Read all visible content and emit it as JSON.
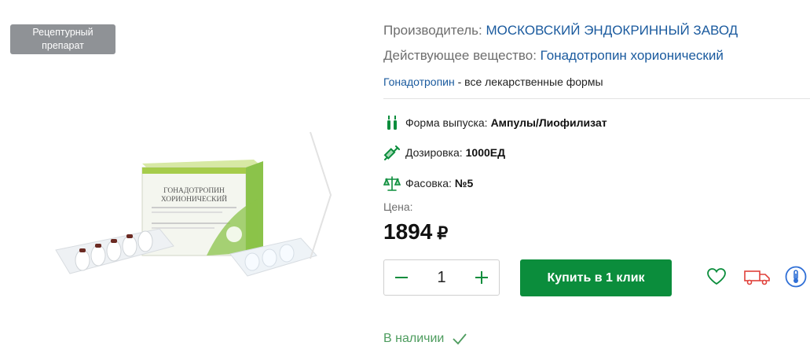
{
  "gallery": {
    "badge_line1": "Рецептурный",
    "badge_line2": "препарат",
    "box_title_line1": "ГОНАДОТРОПИН",
    "box_title_line2": "ХОРИОНИЧЕСКИЙ",
    "next_icon": "chevron-right-icon"
  },
  "product": {
    "manufacturer_label": "Производитель:",
    "manufacturer_value": "МОСКОВСКИЙ ЭНДОКРИННЫЙ ЗАВОД",
    "substance_label": "Действующее вещество:",
    "substance_value": "Гонадотропин хорионический",
    "all_forms_link": "Гонадотропин",
    "all_forms_text": "- все лекарственные формы",
    "form_label": "Форма выпуска:",
    "form_value": "Ампулы/Лиофилизат",
    "dosage_label": "Дозировка:",
    "dosage_value": "1000ЕД",
    "pack_label": "Фасовка:",
    "pack_value": "№5",
    "price_label": "Цена:",
    "price_value": "1894",
    "currency": "₽"
  },
  "cart": {
    "quantity": "1",
    "buy_label": "Купить в 1 клик"
  },
  "actions": {
    "favorite_icon": "heart-icon",
    "delivery_icon": "delivery-truck-icon",
    "temperature_icon": "thermometer-icon"
  },
  "availability": {
    "text": "В наличии"
  },
  "colors": {
    "accent_green": "#0b8d3c",
    "link_blue": "#1a5a9e",
    "delivery_red": "#e0403a",
    "info_blue": "#2f6fd6",
    "badge_gray": "#8f9296"
  }
}
